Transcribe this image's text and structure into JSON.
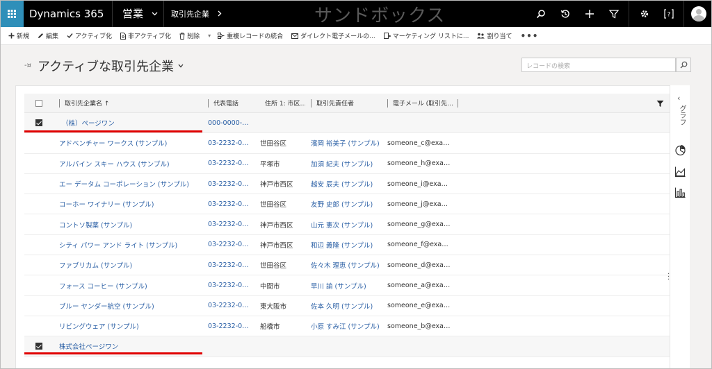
{
  "topbar": {
    "app_title": "Dynamics 365",
    "area": "営業",
    "crumb": "取引先企業",
    "sandbox": "サンドボックス",
    "icons": [
      "search-icon",
      "history-icon",
      "plus-icon",
      "filter-icon",
      "gear-icon",
      "help-icon",
      "avatar"
    ]
  },
  "commands": [
    {
      "label": "新規",
      "icon": "plus-icon"
    },
    {
      "label": "編集",
      "icon": "pencil-icon"
    },
    {
      "label": "アクティブ化",
      "icon": "check-icon"
    },
    {
      "label": "非アクティブ化",
      "icon": "document-icon"
    },
    {
      "label": "削除",
      "icon": "trash-icon"
    },
    {
      "label": "重複レコードの統合",
      "icon": "merge-icon"
    },
    {
      "label": "ダイレクト電子メールの...",
      "icon": "mail-icon"
    },
    {
      "label": "マーケティング リストに...",
      "icon": "list-add-icon"
    },
    {
      "label": "割り当て",
      "icon": "people-icon"
    }
  ],
  "view": {
    "title": "アクティブな取引先企業",
    "search_placeholder": "レコードの検索"
  },
  "columns": {
    "name": "取引先企業名 ↑",
    "phone": "代表電話",
    "city": "住所 1: 市区…",
    "owner": "取引先責任者",
    "email": "電子メール (取引先…"
  },
  "rows": [
    {
      "type": "group",
      "name": "（株）ページワン",
      "phone": "000-0000-…",
      "city": "",
      "owner": "",
      "email": ""
    },
    {
      "type": "row",
      "name": "アドベンチャー ワークス (サンプル)",
      "phone": "03-2232-0…",
      "city": "世田谷区",
      "owner": "濱岡 裕美子 (サンプル)",
      "email": "someone_c@exa…"
    },
    {
      "type": "row",
      "name": "アルパイン スキー ハウス (サンプル)",
      "phone": "03-2232-0…",
      "city": "平塚市",
      "owner": "加須 紀夫 (サンプル)",
      "email": "someone_h@exa…"
    },
    {
      "type": "row",
      "name": "エー データム コーポレーション (サンプル)",
      "phone": "03-2232-0…",
      "city": "神戸市西区",
      "owner": "越安 辰夫 (サンプル)",
      "email": "someone_i@exa…"
    },
    {
      "type": "row",
      "name": "コーホー ワイナリー (サンプル)",
      "phone": "03-2232-0…",
      "city": "世田谷区",
      "owner": "友野 史郎 (サンプル)",
      "email": "someone_j@exa…"
    },
    {
      "type": "row",
      "name": "コントソ製薬 (サンプル)",
      "phone": "03-2232-0…",
      "city": "神戸市西区",
      "owner": "山元 憲次 (サンプル)",
      "email": "someone_g@exa…"
    },
    {
      "type": "row",
      "name": "シティ パワー アンド ライト (サンプル)",
      "phone": "03-2232-0…",
      "city": "神戸市西区",
      "owner": "和辺 義隆 (サンプル)",
      "email": "someone_f@exa…"
    },
    {
      "type": "row",
      "name": "ファブリカム (サンプル)",
      "phone": "03-2232-0…",
      "city": "世田谷区",
      "owner": "佐々木 理恵 (サンプル)",
      "email": "someone_d@exa…"
    },
    {
      "type": "row",
      "name": "フォース コーヒー (サンプル)",
      "phone": "03-2232-0…",
      "city": "中間市",
      "owner": "早川 諭 (サンプル)",
      "email": "someone_a@exa…"
    },
    {
      "type": "row",
      "name": "ブルー ヤンダー航空 (サンプル)",
      "phone": "03-2232-0…",
      "city": "東大阪市",
      "owner": "佐本 久明 (サンプル)",
      "email": "someone_e@exa…"
    },
    {
      "type": "row",
      "name": "リビングウェア (サンプル)",
      "phone": "03-2232-0…",
      "city": "船橋市",
      "owner": "小原 すみ江 (サンプル)",
      "email": "someone_b@exa…"
    },
    {
      "type": "group",
      "name": "株式会社ページワン",
      "phone": "",
      "city": "",
      "owner": "",
      "email": ""
    }
  ],
  "side_pane": {
    "label": "グラフ",
    "icons": [
      "pie-chart-icon",
      "area-chart-icon",
      "bar-chart-icon"
    ]
  },
  "colors": {
    "topbar": "#000000",
    "waffle": "#2f8fb9",
    "link": "#2a5fa5",
    "annotation": "#e00000"
  }
}
